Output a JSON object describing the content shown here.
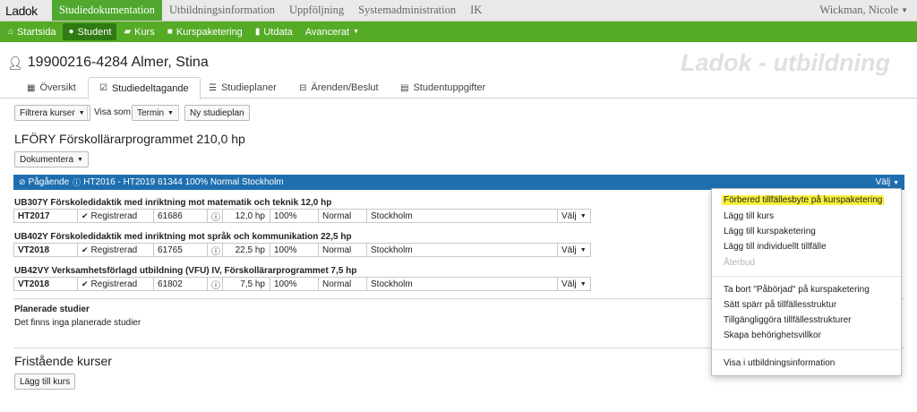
{
  "app": {
    "logo": "Ladok",
    "top_nav": [
      "Studiedokumentation",
      "Utbildningsinformation",
      "Uppföljning",
      "Systemadministration",
      "IK"
    ],
    "user": "Wickman, Nicole"
  },
  "green_menu": [
    {
      "label": "Startsida",
      "icon": "home-icon"
    },
    {
      "label": "Student",
      "icon": "user-icon"
    },
    {
      "label": "Kurs",
      "icon": "book-icon"
    },
    {
      "label": "Kurspaketering",
      "icon": "folder-icon"
    },
    {
      "label": "Utdata",
      "icon": "file-icon"
    },
    {
      "label": "Avancerat"
    }
  ],
  "student": {
    "id_name": "19900216-4284 Almer, Stina"
  },
  "brand_text": "Ladok - utbildning",
  "tabs": [
    {
      "label": "Översikt",
      "icon": "map-icon"
    },
    {
      "label": "Studiedeltagande",
      "icon": "checkbox-icon"
    },
    {
      "label": "Studieplaner",
      "icon": "list-icon"
    },
    {
      "label": "Ärenden/Beslut",
      "icon": "inbox-icon"
    },
    {
      "label": "Studentuppgifter",
      "icon": "document-icon"
    }
  ],
  "toolbar": {
    "filter": "Filtrera kurser",
    "visa_som": "Visa som",
    "termin": "Termin",
    "ny_studieplan": "Ny studieplan"
  },
  "program": {
    "title": "LFÖRY Förskollärarprogrammet 210,0 hp",
    "dokumentera": "Dokumentera",
    "status": "Pågående",
    "period": "HT2016 - HT2019 61344 100% Normal Stockholm",
    "valj": "Välj"
  },
  "courses": [
    {
      "title": "UB307Y Förskoledidaktik med inriktning mot matematik och teknik 12,0 hp",
      "term": "HT2017",
      "status": "Registrerad",
      "code": "61686",
      "hp": "12,0 hp",
      "pace": "100%",
      "type": "Normal",
      "place": "Stockholm",
      "valj": "Välj"
    },
    {
      "title": "UB402Y Förskoledidaktik med inriktning mot språk och kommunikation 22,5 hp",
      "term": "VT2018",
      "status": "Registrerad",
      "code": "61765",
      "hp": "22,5 hp",
      "pace": "100%",
      "type": "Normal",
      "place": "Stockholm",
      "valj": "Välj"
    },
    {
      "title": "UB42VY Verksamhetsförlagd utbildning (VFU) IV, Förskollärarprogrammet 7,5 hp",
      "term": "VT2018",
      "status": "Registrerad",
      "code": "61802",
      "hp": "7,5 hp",
      "pace": "100%",
      "type": "Normal",
      "place": "Stockholm",
      "valj": "Välj"
    }
  ],
  "planned": {
    "title": "Planerade studier",
    "empty": "Det finns inga planerade studier"
  },
  "freestanding": {
    "title": "Fristående kurser",
    "add": "Lägg till kurs"
  },
  "dropdown": {
    "items": [
      "Förbered tillfällesbyte på kurspaketering",
      "Lägg till kurs",
      "Lägg till kurspaketering",
      "Lägg till individuellt tillfälle",
      "Återbud",
      "Ta bort \"Påbörjad\" på kurspaketering",
      "Sätt spärr på tillfällesstruktur",
      "Tillgängliggöra tillfällesstrukturer",
      "Skapa behörighetsvillkor",
      "Visa i utbildningsinformation"
    ],
    "highlight_color": "#f7f03a"
  },
  "colors": {
    "green": "#55ab26",
    "green_active": "#4fa82d",
    "blue": "#1f6fb0"
  }
}
